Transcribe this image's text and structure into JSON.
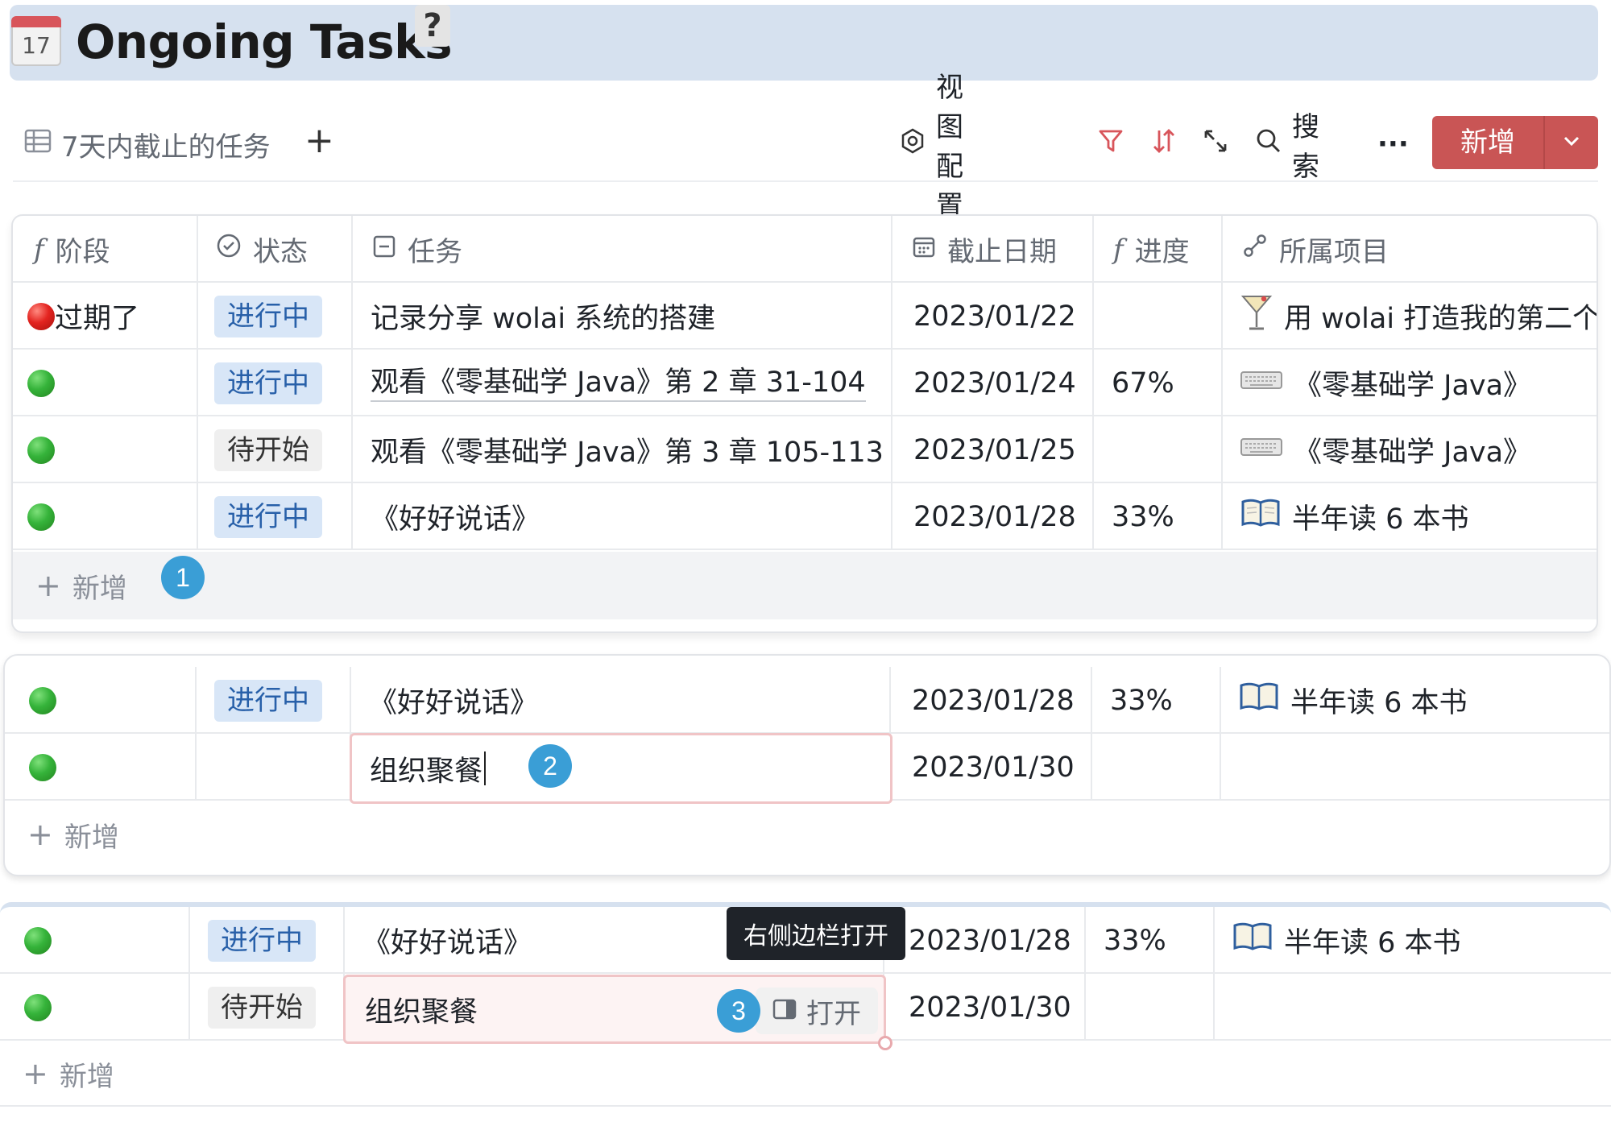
{
  "page": {
    "title": "Ongoing Tasks",
    "calendar_icon_day": "17",
    "help_glyph": "?"
  },
  "toolbar": {
    "view_name": "7天内截止的任务",
    "add_view_glyph": "+",
    "view_config_label": "视图配置",
    "search_label": "搜索",
    "more_glyph": "···",
    "new_label": "新增",
    "filter_color": "#d8555b",
    "new_button_color": "#c95555"
  },
  "columns": {
    "stage": "阶段",
    "status": "状态",
    "task": "任务",
    "due": "截止日期",
    "progress": "进度",
    "project": "所属项目"
  },
  "table1": {
    "rows": [
      {
        "stage_dot": "red",
        "stage_text": "过期了",
        "status": "进行中",
        "status_style": "blue",
        "task": "记录分享 wolai 系统的搭建",
        "due": "2023/01/22",
        "progress": "",
        "project_icon": "cocktail-icon",
        "project": "用 wolai 打造我的第二个"
      },
      {
        "stage_dot": "green",
        "stage_text": "",
        "status": "进行中",
        "status_style": "blue",
        "task": "观看《零基础学 Java》第 2 章 31-104",
        "due": "2023/01/24",
        "progress": "67%",
        "project_icon": "keyboard-icon",
        "project": "《零基础学 Java》"
      },
      {
        "stage_dot": "green",
        "stage_text": "",
        "status": "待开始",
        "status_style": "grey",
        "task": "观看《零基础学 Java》第 3 章 105-113",
        "due": "2023/01/25",
        "progress": "",
        "project_icon": "keyboard-icon",
        "project": "《零基础学 Java》"
      },
      {
        "stage_dot": "green",
        "stage_text": "",
        "status": "进行中",
        "status_style": "blue",
        "task": "《好好说话》",
        "due": "2023/01/28",
        "progress": "33%",
        "project_icon": "book-icon",
        "project": "半年读 6 本书"
      }
    ],
    "add_label": "新增",
    "badge": "1"
  },
  "table2": {
    "row_a": {
      "status": "进行中",
      "task": "《好好说话》",
      "due": "2023/01/28",
      "progress": "33%",
      "project": "半年读 6 本书"
    },
    "row_b": {
      "status": "",
      "task": "组织聚餐",
      "due": "2023/01/30"
    },
    "add_label": "新增",
    "badge": "2"
  },
  "table3": {
    "row_a": {
      "status": "进行中",
      "task": "《好好说话》",
      "due": "2023/01/28",
      "progress": "33%",
      "project": "半年读 6 本书"
    },
    "row_b": {
      "status": "待开始",
      "task": "组织聚餐",
      "due": "2023/01/30"
    },
    "tooltip": "右侧边栏打开",
    "open_label": "打开",
    "add_label": "新增",
    "badge": "3"
  }
}
